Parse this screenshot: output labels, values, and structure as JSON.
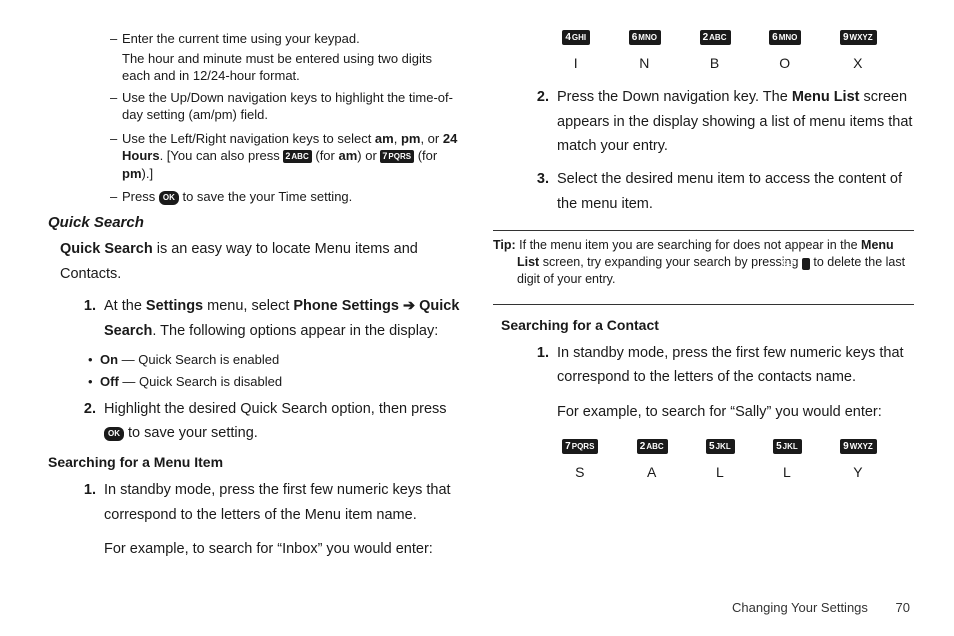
{
  "left": {
    "time_bullets": {
      "d1a": "Enter the current time using your keypad.",
      "d1b": "The hour and minute must be entered using two digits each and in 12/24-hour format.",
      "d2": "Use the Up/Down navigation keys to highlight the time-of-day setting (am/pm) field.",
      "d3a": "Use the Left/Right navigation keys to select ",
      "d3_am": "am",
      "d3_c1": ", ",
      "d3_pm": "pm",
      "d3_c2": ", or ",
      "d3_24": "24 Hours",
      "d3b": ". [You can also press ",
      "d3_for_am1": " (for ",
      "d3_for_am2": ") or ",
      "d3_for_pm1": " (for ",
      "d3_for_pm2": ").]",
      "d4a": "Press ",
      "d4b": " to save the your Time setting."
    },
    "qs_heading": "Quick Search",
    "qs_intro_b": "Quick Search",
    "qs_intro_r": " is an easy way to locate Menu items and Contacts.",
    "ol1_1a": "At the ",
    "ol1_1b": "Settings",
    "ol1_1c": " menu, select ",
    "ol1_1d": "Phone Settings ➔ Quick Search",
    "ol1_1e": ". The following options appear in the display:",
    "on_b": "On",
    "on_r": " — Quick Search is enabled",
    "off_b": "Off",
    "off_r": " — Quick Search is disabled",
    "ol1_2a": "Highlight the desired Quick Search option, then press ",
    "ol1_2b": " to save your setting.",
    "smi_heading": "Searching for a Menu Item",
    "smi_1": "In standby mode, press the first few numeric keys that correspond to the letters of the Menu item name.",
    "smi_ex": "For example, to search for “Inbox” you would enter:"
  },
  "keys_inbox": [
    {
      "num": "4",
      "lab": "GHI",
      "letter": "I"
    },
    {
      "num": "6",
      "lab": "MNO",
      "letter": "N"
    },
    {
      "num": "2",
      "lab": "ABC",
      "letter": "B"
    },
    {
      "num": "6",
      "lab": "MNO",
      "letter": "O"
    },
    {
      "num": "9",
      "lab": "WXYZ",
      "letter": "X"
    }
  ],
  "right": {
    "ol_2a": "Press the Down navigation key. The ",
    "ol_2b": "Menu List",
    "ol_2c": " screen appears in the display showing a list of menu items that match your entry.",
    "ol_3": "Select the desired menu item to access the content of the menu item.",
    "tip_b": "Tip:",
    "tip_1": " If the menu item you are searching for does not appear in the ",
    "tip_ml": "Menu List",
    "tip_2": " screen, try expanding your search by pressing ",
    "tip_3": " to delete the last digit of your entry.",
    "sc_heading": "Searching for a Contact",
    "sc_1": "In standby mode, press the first few numeric keys that correspond to the letters of the contacts name.",
    "sc_ex": "For example, to search for “Sally” you would enter:"
  },
  "keys_sally": [
    {
      "num": "7",
      "lab": "PQRS",
      "letter": "S"
    },
    {
      "num": "2",
      "lab": "ABC",
      "letter": "A"
    },
    {
      "num": "5",
      "lab": "JKL",
      "letter": "L"
    },
    {
      "num": "5",
      "lab": "JKL",
      "letter": "L"
    },
    {
      "num": "9",
      "lab": "WXYZ",
      "letter": "Y"
    }
  ],
  "inline_keys": {
    "k2": {
      "num": "2",
      "lab": "ABC"
    },
    "k7": {
      "num": "7",
      "lab": "PQRS"
    },
    "ok": "OK",
    "clr": "CLR"
  },
  "footer": {
    "section": "Changing Your Settings",
    "page": "70"
  }
}
